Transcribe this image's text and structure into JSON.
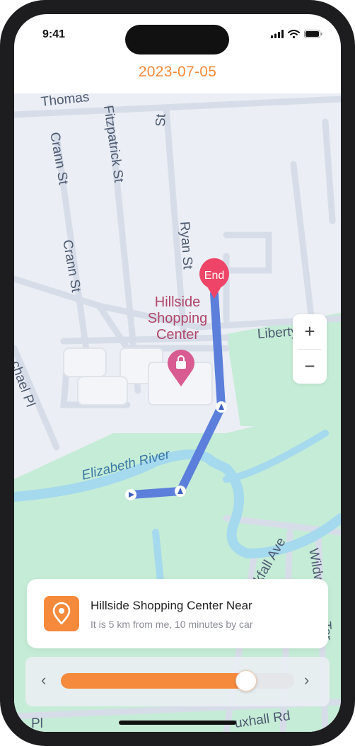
{
  "status_bar": {
    "time": "9:41"
  },
  "header": {
    "date": "2023-07-05"
  },
  "map": {
    "street_labels": {
      "thomas": "Thomas",
      "fitzpatrick": "Fitzpatrick St",
      "st_top": "St",
      "crann_1": "Crann St",
      "crann_2": "Crann St",
      "ryan": "Ryan St",
      "liberty": "Liberty Ave",
      "michael": "chael Pl",
      "river": "Elizabeth River",
      "brookfall": "ookfall Ave",
      "wildwood": "Wildw",
      "terrace": "Ter",
      "vauxhall": "uxhall Rd",
      "pl_bottom": "Pl"
    },
    "poi": {
      "line1": "Hillside",
      "line2": "Shopping",
      "line3": "Center"
    },
    "end_marker": "End",
    "zoom_in": "+",
    "zoom_out": "−",
    "colors": {
      "route": "#5b7fdb",
      "park": "#c5ecd6",
      "river": "#a5d9ee",
      "marker": "#ee4467"
    }
  },
  "info_card": {
    "title": "Hillside Shopping Center Near",
    "subtitle": "It is 5 km from me, 10 minutes by car",
    "icon": "location-pin-icon"
  },
  "playback": {
    "prev": "‹",
    "next": "›",
    "progress": 0.79,
    "accent": "#f58a3c"
  }
}
